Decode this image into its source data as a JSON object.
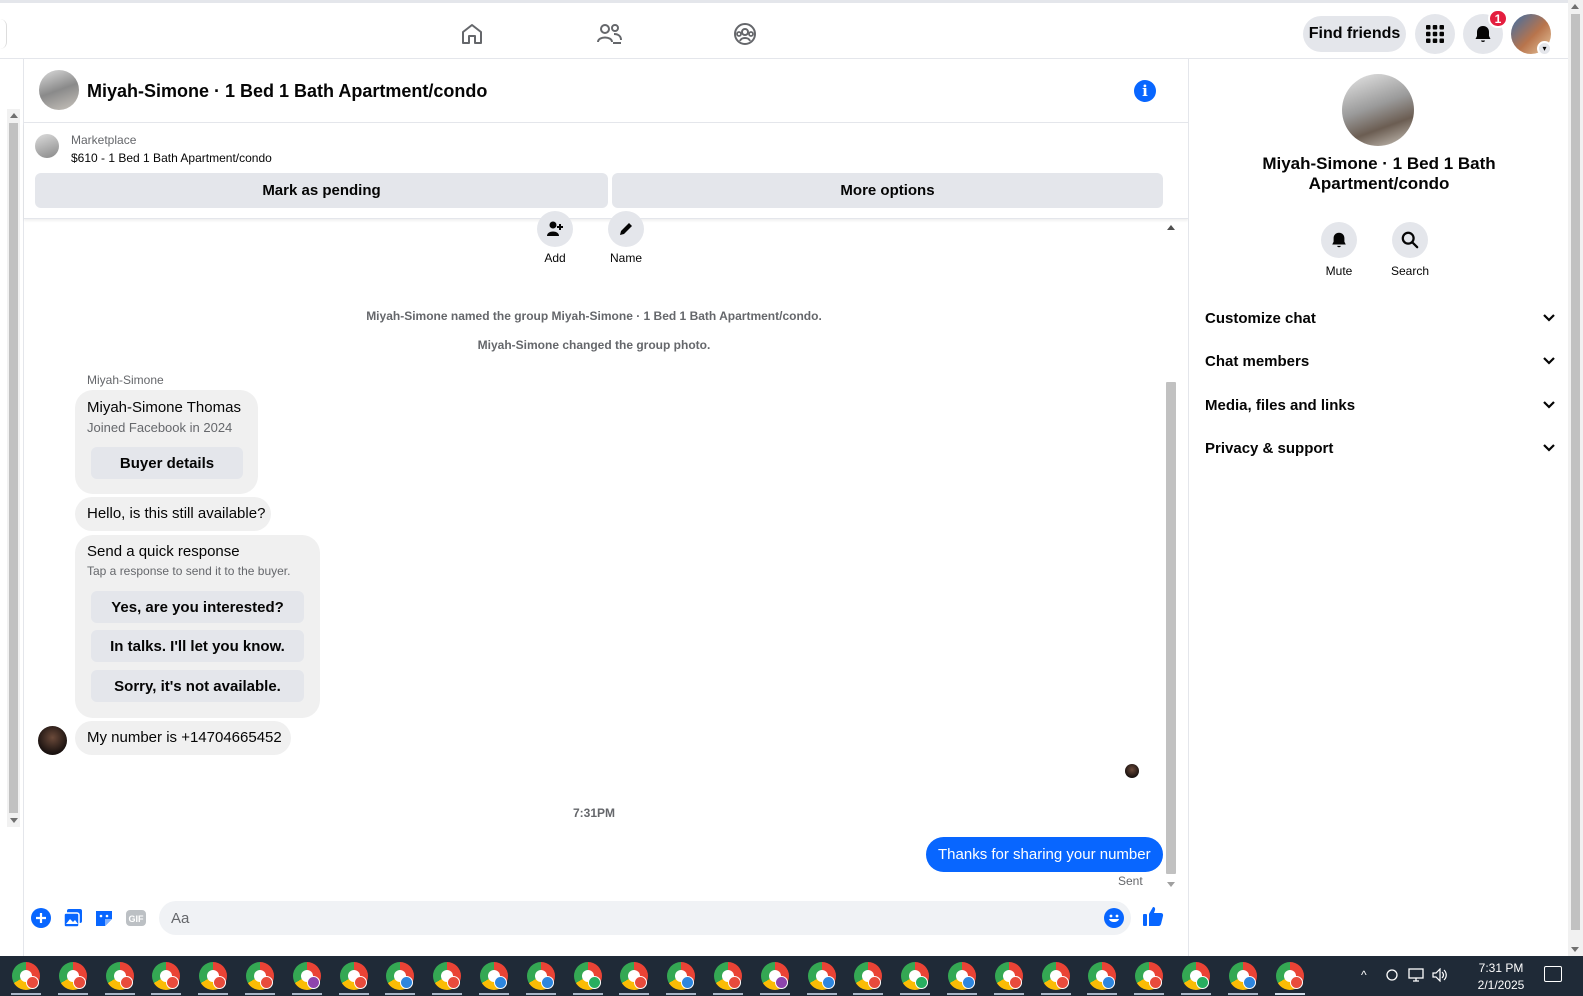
{
  "topbar": {
    "find_friends": "Find friends",
    "notification_count": "1",
    "nav_icons": [
      "home-icon",
      "friends-icon",
      "groups-icon"
    ]
  },
  "chat": {
    "title": "Miyah-Simone · 1 Bed 1 Bath Apartment/condo",
    "marketplace": {
      "label": "Marketplace",
      "listing": "$610 - 1 Bed 1 Bath Apartment/condo",
      "mark_pending": "Mark as pending",
      "more_options": "More options"
    },
    "actions": {
      "add": "Add",
      "name": "Name"
    },
    "system_messages": [
      "Miyah-Simone named the group Miyah-Simone · 1 Bed 1 Bath Apartment/condo.",
      "Miyah-Simone changed the group photo."
    ],
    "sender_name": "Miyah-Simone",
    "profile_card": {
      "name": "Miyah-Simone Thomas",
      "joined": "Joined Facebook in 2024",
      "button": "Buyer details"
    },
    "message_1": "Hello, is this still available?",
    "quick_response": {
      "title": "Send a quick response",
      "subtitle": "Tap a response to send it to the buyer.",
      "options": [
        "Yes, are you interested?",
        "In talks. I'll let you know.",
        "Sorry, it's not available."
      ]
    },
    "message_2": "My number is +14704665452",
    "timestamp": "7:31PM",
    "outgoing": "Thanks for sharing your number",
    "status": "Sent",
    "composer_placeholder": "Aa"
  },
  "right_panel": {
    "title": "Miyah-Simone · 1 Bed 1 Bath Apartment/condo",
    "mute": "Mute",
    "search": "Search",
    "sections": [
      "Customize chat",
      "Chat members",
      "Media, files and links",
      "Privacy & support"
    ]
  },
  "taskbar": {
    "time": "7:31 PM",
    "date": "2/1/2025"
  },
  "colors": {
    "accent": "#0866ff",
    "badge": "#e41e3f",
    "button_bg": "#e4e6eb",
    "bubble_bg": "#f0f0f0",
    "taskbar": "#1f2a37"
  }
}
